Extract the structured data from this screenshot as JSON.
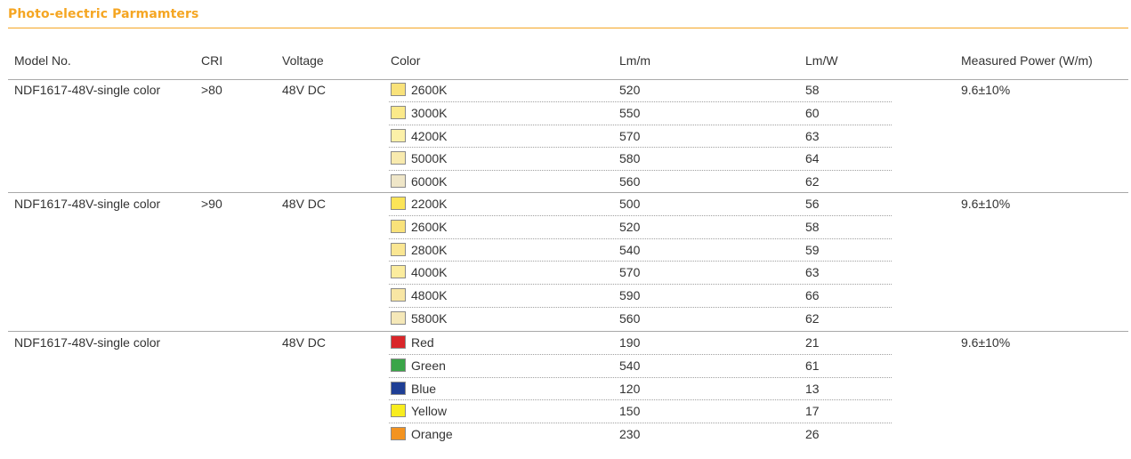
{
  "title": "Photo-electric Parmamters",
  "headers": {
    "model": "Model No.",
    "cri": "CRI",
    "voltage": "Voltage",
    "color": "Color",
    "lm_m": "Lm/m",
    "lm_w": "Lm/W",
    "power": "Measured Power (W/m)"
  },
  "groups": [
    {
      "model": "NDF1617-48V-single color",
      "cri": ">80",
      "voltage": "48V DC",
      "power": "9.6±10%",
      "rows": [
        {
          "color": "2600K",
          "swatch": "#f9e27a",
          "lm_m": "520",
          "lm_w": "58"
        },
        {
          "color": "3000K",
          "swatch": "#fbe98a",
          "lm_m": "550",
          "lm_w": "60"
        },
        {
          "color": "4200K",
          "swatch": "#fcf0a8",
          "lm_m": "570",
          "lm_w": "63"
        },
        {
          "color": "5000K",
          "swatch": "#f8eaae",
          "lm_m": "580",
          "lm_w": "64"
        },
        {
          "color": "6000K",
          "swatch": "#efe6c8",
          "lm_m": "560",
          "lm_w": "62"
        }
      ]
    },
    {
      "model": "NDF1617-48V-single color",
      "cri": ">90",
      "voltage": "48V DC",
      "power": "9.6±10%",
      "rows": [
        {
          "color": "2200K",
          "swatch": "#fbe458",
          "lm_m": "500",
          "lm_w": "56"
        },
        {
          "color": "2600K",
          "swatch": "#f9e27a",
          "lm_m": "520",
          "lm_w": "58"
        },
        {
          "color": "2800K",
          "swatch": "#fae692",
          "lm_m": "540",
          "lm_w": "59"
        },
        {
          "color": "4000K",
          "swatch": "#fbec9e",
          "lm_m": "570",
          "lm_w": "63"
        },
        {
          "color": "4800K",
          "swatch": "#f8e6a4",
          "lm_m": "590",
          "lm_w": "66"
        },
        {
          "color": "5800K",
          "swatch": "#f5e8b8",
          "lm_m": "560",
          "lm_w": "62"
        }
      ]
    },
    {
      "model": "NDF1617-48V-single color",
      "cri": "",
      "voltage": "48V DC",
      "power": "9.6±10%",
      "rows": [
        {
          "color": "Red",
          "swatch": "#d9262a",
          "lm_m": "190",
          "lm_w": "21"
        },
        {
          "color": "Green",
          "swatch": "#3aa548",
          "lm_m": "540",
          "lm_w": "61"
        },
        {
          "color": "Blue",
          "swatch": "#1f3f95",
          "lm_m": "120",
          "lm_w": "13"
        },
        {
          "color": "Yellow",
          "swatch": "#f8ed1f",
          "lm_m": "150",
          "lm_w": "17"
        },
        {
          "color": "Orange",
          "swatch": "#f39320",
          "lm_m": "230",
          "lm_w": "26"
        }
      ]
    }
  ]
}
